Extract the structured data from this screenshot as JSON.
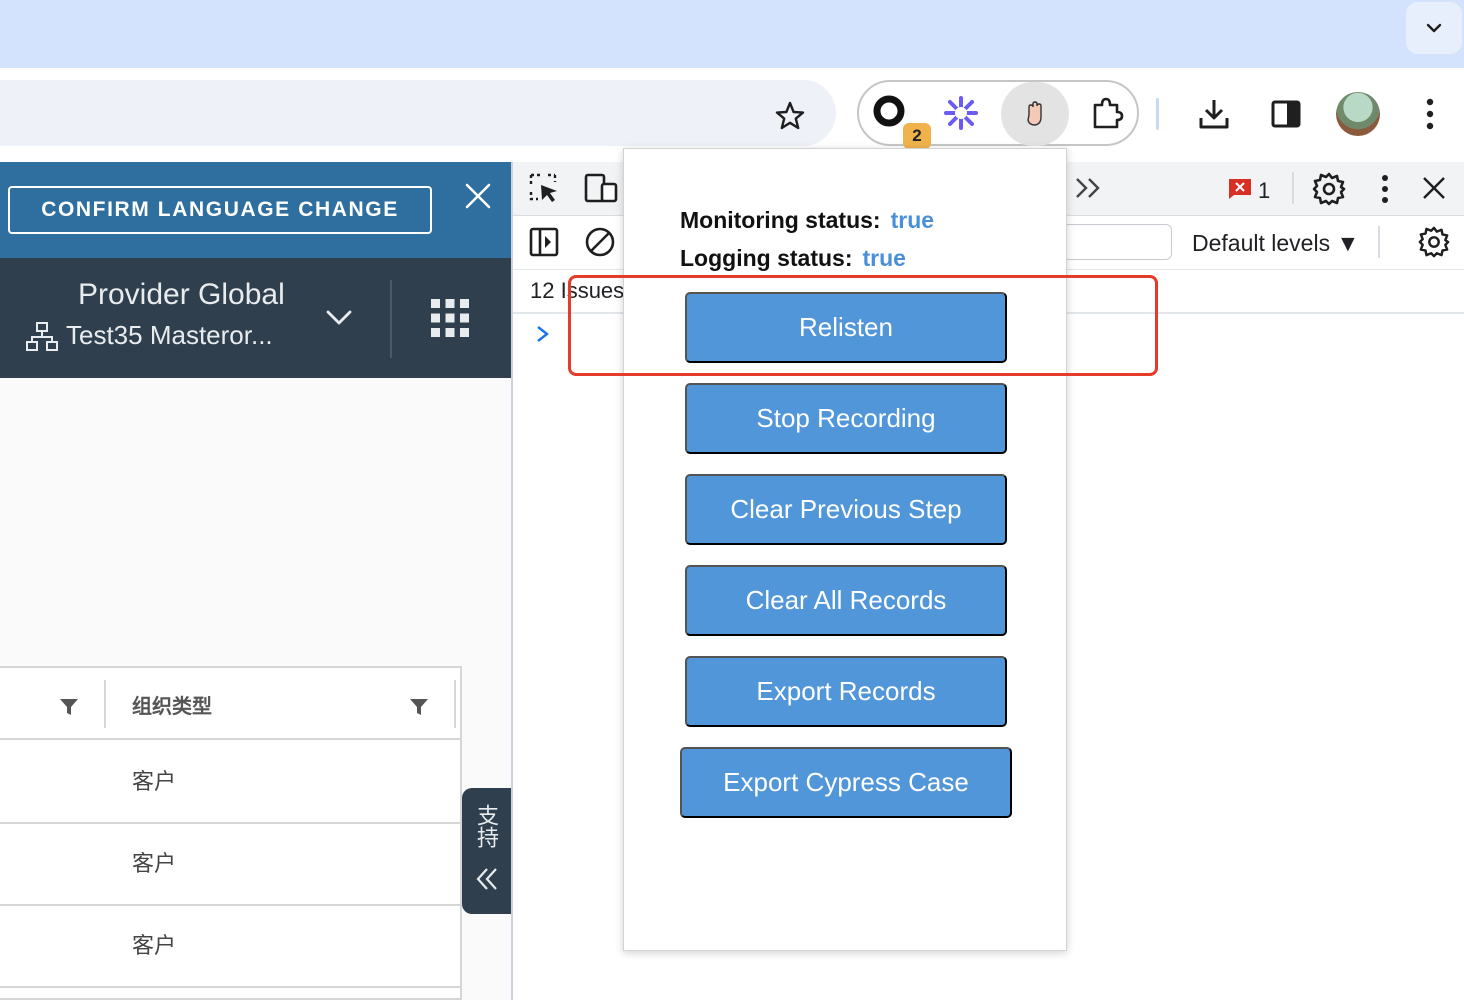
{
  "browser": {
    "extension_badge": "2",
    "error_count": "1"
  },
  "alert": {
    "confirm_label": "CONFIRM LANGUAGE CHANGE"
  },
  "header": {
    "provider": "Provider Global",
    "org": "Test35 Masteror..."
  },
  "table": {
    "column_header": "组织类型",
    "rows": [
      "客户",
      "客户",
      "客户"
    ]
  },
  "support": {
    "label": "支持"
  },
  "devtools": {
    "default_levels": "Default levels ▼",
    "issues": "12 Issues"
  },
  "popup": {
    "monitoring_label": "Monitoring status:",
    "monitoring_value": "true",
    "logging_label": "Logging status:",
    "logging_value": "true",
    "buttons": [
      "Relisten",
      "Stop Recording",
      "Clear Previous Step",
      "Clear All Records",
      "Export Records",
      "Export Cypress Case"
    ]
  },
  "colors": {
    "popup_button": "#5096d8",
    "status_value": "#4a90d9",
    "highlight": "#e53b2b",
    "alert_bar": "#2f6f9f",
    "app_header": "#2f3f4d"
  }
}
